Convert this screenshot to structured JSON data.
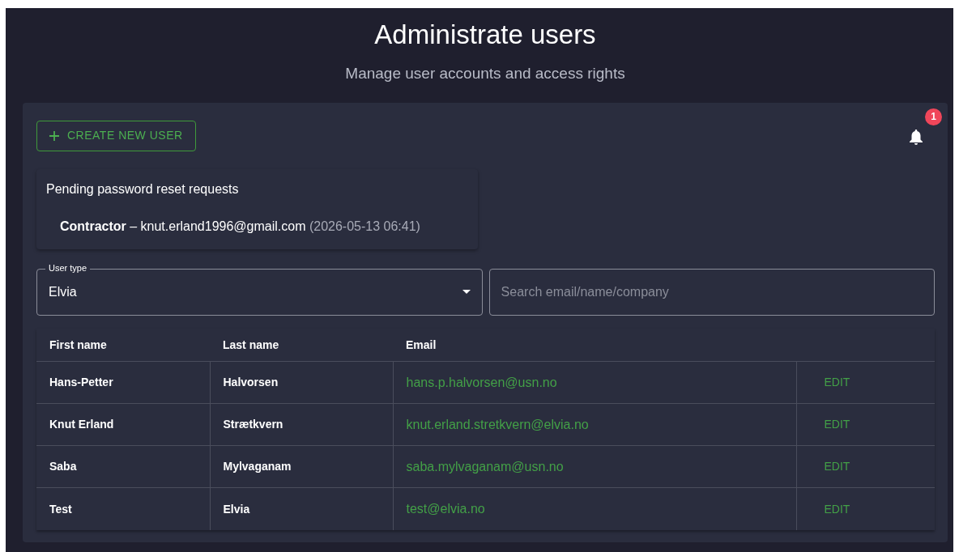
{
  "header": {
    "title": "Administrate users",
    "subtitle": "Manage user accounts and access rights"
  },
  "create_button": {
    "label": "CREATE NEW USER"
  },
  "notifications": {
    "count": "1"
  },
  "reset_requests": {
    "title": "Pending password reset requests",
    "items": [
      {
        "text": "**Contractor** – knut.erland1996@gmail.com",
        "time": "(2026-05-13 06:41)"
      }
    ]
  },
  "user_type": {
    "label": "User type",
    "value": "Elvia"
  },
  "search": {
    "placeholder": "Search email/name/company"
  },
  "table": {
    "columns": [
      "First name",
      "Last name",
      "Email",
      ""
    ],
    "rows": [
      {
        "first": "Hans-Petter",
        "last": "Halvorsen",
        "email": "hans.p.halvorsen@usn.no",
        "action": "EDIT"
      },
      {
        "first": "Knut Erland",
        "last": "Strætkvern",
        "email": "knut.erland.stretkvern@elvia.no",
        "action": "EDIT"
      },
      {
        "first": "Saba",
        "last": "Mylvaganam",
        "email": "saba.mylvaganam@usn.no",
        "action": "EDIT"
      },
      {
        "first": "Test",
        "last": "Elvia",
        "email": "test@elvia.no",
        "action": "EDIT"
      }
    ]
  }
}
